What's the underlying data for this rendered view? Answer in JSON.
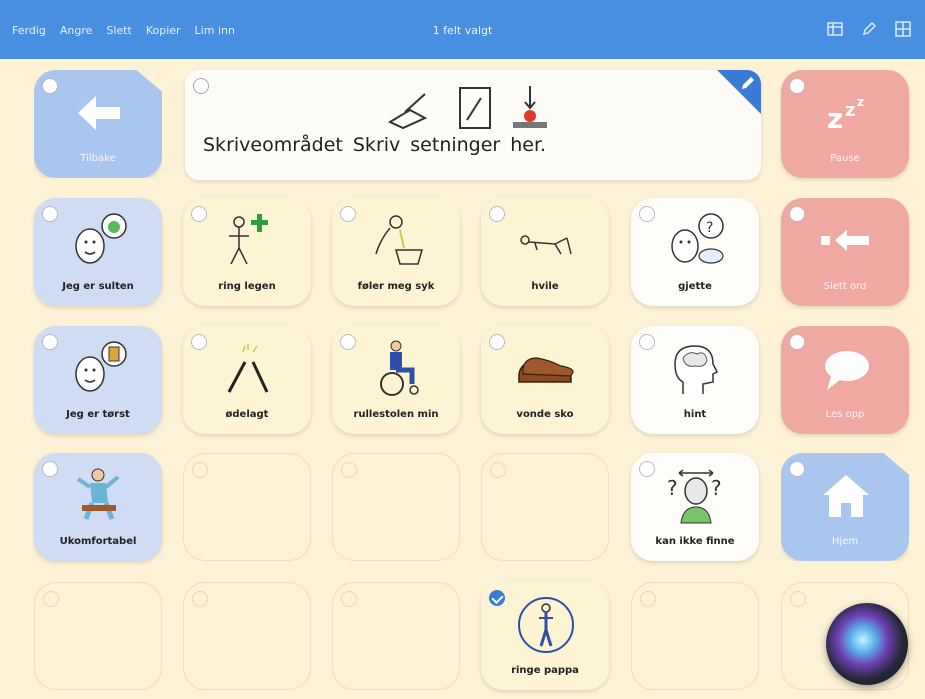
{
  "topbar": {
    "actions": [
      "Ferdig",
      "Angre",
      "Slett",
      "Kopier",
      "Lim inn"
    ],
    "status": "1 felt valgt",
    "icons": [
      "grid-table-icon",
      "pencil-icon",
      "grid-icon"
    ]
  },
  "writing_area": {
    "words": [
      "Skriveområdet",
      "Skriv",
      "setninger",
      "her."
    ]
  },
  "cells": {
    "tilbake": "Tilbake",
    "pause": "Pause",
    "jeg_er_sulten": "Jeg er sulten",
    "ring_legen": "ring legen",
    "foler_meg_syk": "føler meg syk",
    "hvile": "hvile",
    "gjette": "gjette",
    "slett_ord": "Slett ord",
    "jeg_er_torst": "Jeg er tørst",
    "odelagt": "ødelagt",
    "rullestolen_min": "rullestolen min",
    "vonde_sko": "vonde sko",
    "hint": "hint",
    "les_opp": "Les opp",
    "ukomfortabel": "Ukomfortabel",
    "kan_ikke_finne": "kan ikke finne",
    "hjem": "Hjem",
    "ringe_pappa": "ringe pappa"
  },
  "colors": {
    "topbar": "#4a90e2",
    "background": "#fdf1d6",
    "selected": "#3a7bd5"
  }
}
